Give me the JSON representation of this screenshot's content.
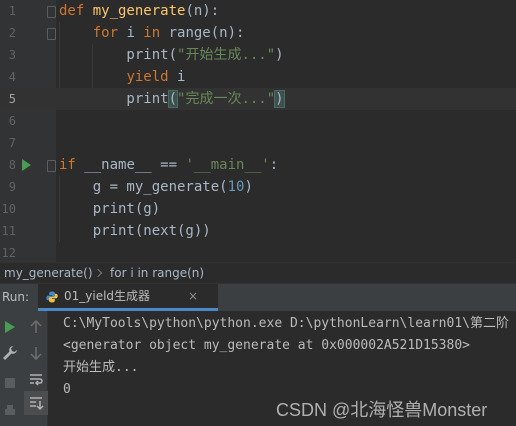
{
  "editor": {
    "lines": [
      {
        "n": "1",
        "tokens": [
          [
            "kw",
            "def "
          ],
          [
            "fn",
            "my_generate"
          ],
          [
            "plain",
            "(n):"
          ]
        ]
      },
      {
        "n": "2",
        "tokens": [
          [
            "plain",
            "    "
          ],
          [
            "kw",
            "for "
          ],
          [
            "plain",
            "i "
          ],
          [
            "kw",
            "in "
          ],
          [
            "plain",
            "range(n):"
          ]
        ]
      },
      {
        "n": "3",
        "tokens": [
          [
            "plain",
            "        print("
          ],
          [
            "str",
            "\"开始生成...\""
          ],
          [
            "plain",
            ")"
          ]
        ]
      },
      {
        "n": "4",
        "tokens": [
          [
            "plain",
            "        "
          ],
          [
            "kw",
            "yield "
          ],
          [
            "plain",
            "i"
          ]
        ]
      },
      {
        "n": "5",
        "tokens": [
          [
            "plain",
            "        print"
          ],
          [
            "hl",
            "("
          ],
          [
            "str",
            "\"完成一次...\""
          ],
          [
            "hl",
            ")"
          ]
        ],
        "current": true
      },
      {
        "n": "6",
        "tokens": []
      },
      {
        "n": "7",
        "tokens": []
      },
      {
        "n": "8",
        "tokens": [
          [
            "kw",
            "if "
          ],
          [
            "plain",
            "__name__ == "
          ],
          [
            "str",
            "'__main__'"
          ],
          [
            "plain",
            ":"
          ]
        ],
        "run": true
      },
      {
        "n": "9",
        "tokens": [
          [
            "plain",
            "    g = my_generate("
          ],
          [
            "num",
            "10"
          ],
          [
            "plain",
            ")"
          ]
        ]
      },
      {
        "n": "10",
        "tokens": [
          [
            "plain",
            "    print(g)"
          ]
        ]
      },
      {
        "n": "11",
        "tokens": [
          [
            "plain",
            "    print(next(g))"
          ]
        ]
      },
      {
        "n": "12",
        "tokens": []
      }
    ],
    "colors": {
      "keyword": "#cc7832",
      "function": "#ffc66d",
      "string": "#6a8759",
      "number": "#6897bb",
      "plain": "#a9b7c6"
    }
  },
  "breadcrumbs": {
    "items": [
      "my_generate()",
      "for i in range(n)"
    ]
  },
  "run_panel": {
    "title": "Run:",
    "tab_label": "01_yield生成器",
    "tab_icon": "python-icon",
    "close_glyph": "×",
    "accent": "#4a88c7",
    "tools": [
      "rerun-icon",
      "stop-icon",
      "up-arrow-icon",
      "down-arrow-icon",
      "settings-wrench-icon",
      "soft-wrap-icon",
      "scroll-to-end-icon",
      "print-icon"
    ]
  },
  "console": {
    "lines": [
      "C:\\MyTools\\python\\python.exe D:\\pythonLearn\\learn01\\第二阶",
      "<generator object my_generate at 0x000002A521D15380>",
      "开始生成...",
      "0"
    ]
  },
  "watermark": "CSDN @北海怪兽Monster"
}
